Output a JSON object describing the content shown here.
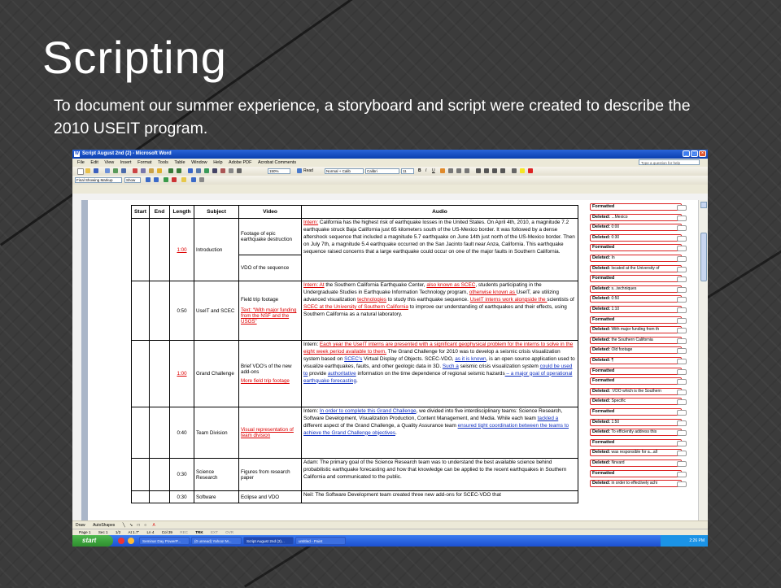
{
  "slide": {
    "title": "Scripting",
    "body": "To document our summer experience, a storyboard and script were created to describe the 2010 USEIT program."
  },
  "window": {
    "title": "Script August 2nd (2) - Microsoft Word",
    "help_box": "Type a question for help",
    "menu": [
      "File",
      "Edit",
      "View",
      "Insert",
      "Format",
      "Tools",
      "Table",
      "Window",
      "Help",
      "Adobe PDF",
      "Acrobat Comments"
    ],
    "zoom": "150%",
    "read_label": "Read",
    "style_value": "Normal + Calib",
    "font_value": "Calibri",
    "size_value": "11",
    "markup_view": "Final Showing Markup",
    "show_label": "Show"
  },
  "table": {
    "headers": [
      "Start",
      "End",
      "Length",
      "Subject",
      "Video",
      "Audio"
    ],
    "rows": [
      {
        "length": "1:00",
        "subject": "Introduction",
        "video_a": "Footage of epic earthquake destruction",
        "video_b": "VDO of the sequence",
        "audio_ins": "Intern:",
        "audio_text": " California has the highest risk of earthquake losses in the United States. On April 4th, 2010, a magnitude 7.2 earthquake struck Baja California just 65 kilometers south of the US-Mexico border. It was followed by a dense aftershock sequence that included a magnitude 5.7 earthquake on June 14th just north of the US-Mexico border. Then on July 7th, a magnitude 5.4 earthquake occurred on the San Jacinto fault near Anza, California. This earthquake sequence raised concerns that a large earthquake could occur on one of the major faults in Southern California."
      },
      {
        "length": "0:50",
        "subject": "UseIT and SCEC",
        "video_a": "Field trip footage",
        "video_ins": "Text: “With major funding from the NSF and the USGS”",
        "audio_a": "Intern: At",
        "audio_b": " the Southern California Earthquake Center, ",
        "audio_c": "also known as SCEC",
        "audio_d": ", students participating in the Undergraduate Studies in Earthquake Information Technology program, ",
        "audio_e": "otherwise known as ",
        "audio_f": "UseIT, are utilizing advanced visualization ",
        "audio_g": "technologies",
        "audio_h": " to study this earthquake sequence. ",
        "audio_i": "UseIT interns work alongside the ",
        "audio_j": "scientists of ",
        "audio_k": "SCEC at the University of Southern California",
        "audio_l": " to improve our understanding of earthquakes and their effects, using Southern California as a natural laboratory."
      },
      {
        "length": "1:00",
        "subject": "Grand Challenge",
        "video_a": "Brief VDO’s of the new add-ons",
        "video_ins": "More field trip footage",
        "audio_a": "Intern: ",
        "audio_b": "Each year the UseIT interns are presented with a significant geophysical problem for the interns to solve in the eight week period available to them.",
        "audio_c": " The Grand Challenge for 2010 was to develop a seismic crisis visualization system based on ",
        "audio_d": "SCEC’s",
        "audio_e": " Virtual Display of Objects. SCEC-VDO, ",
        "audio_f": "as it is known",
        "audio_g": ", is an open source application used to visualize earthquakes, faults, and other geologic data in 3D. ",
        "audio_h": "Such a",
        "audio_i": " seismic crisis visualization system ",
        "audio_j": "could be used to",
        "audio_k": " provide ",
        "audio_l": "authoritative",
        "audio_m": " information on the time dependence of regional seismic hazards",
        "audio_n": " – a major goal of operational earthquake forecasting",
        "audio_o": "."
      },
      {
        "length": "0:40",
        "subject": "Team Division",
        "video_ins": "Visual representation of team division",
        "audio_a": "Intern: ",
        "audio_b": "In order to complete this Grand Challenge",
        "audio_c": ", we divided into five interdisciplinary teams: Science Research, Software Development, Visualization Production, Content Management, and Media. While each team ",
        "audio_d": "tackled a",
        "audio_e": " different aspect of the Grand Challenge, a Quality Assurance team ",
        "audio_f": "ensured tight coordination between the teams to achieve the Grand Challenge objectives",
        "audio_g": "."
      },
      {
        "length": "0:30",
        "subject": "Science Research",
        "video_a": "Figures from research paper",
        "audio": "Adam: The primary goal of the Science Research team was to understand the best available science behind probabilistic earthquake forecasting and how that knowledge can be applied to the recent earthquakes in Southern California and communicated to the public."
      },
      {
        "length": "0:30",
        "subject": "Software",
        "video_a": "Eclipse and VDO",
        "audio": "Neil: The Software Development team created three new add-ons for SCEC-VDO that"
      }
    ]
  },
  "balloons": [
    {
      "label": "Formatted",
      "detail": ""
    },
    {
      "label": "Deleted:",
      "detail": "...Mexico"
    },
    {
      "label": "Deleted:",
      "detail": "0:00"
    },
    {
      "label": "Deleted:",
      "detail": "0:30"
    },
    {
      "label": "Formatted",
      "detail": ""
    },
    {
      "label": "Deleted:",
      "detail": "In"
    },
    {
      "label": "Deleted:",
      "detail": "located at the University of"
    },
    {
      "label": "Formatted",
      "detail": ""
    },
    {
      "label": "Deleted:",
      "detail": "s...techniques"
    },
    {
      "label": "Deleted:",
      "detail": "0:50"
    },
    {
      "label": "Deleted:",
      "detail": "1:10"
    },
    {
      "label": "Formatted",
      "detail": ""
    },
    {
      "label": "Deleted:",
      "detail": "With major funding from th"
    },
    {
      "label": "Deleted:",
      "detail": " the Southern California"
    },
    {
      "label": "Deleted:",
      "detail": "Old footage"
    },
    {
      "label": "Deleted:",
      "detail": "¶"
    },
    {
      "label": "Formatted",
      "detail": ""
    },
    {
      "label": "Formatted",
      "detail": ""
    },
    {
      "label": "Deleted:",
      "detail": ":VDO which is the Southern"
    },
    {
      "label": "Deleted:",
      "detail": "Specific"
    },
    {
      "label": "Formatted",
      "detail": ""
    },
    {
      "label": "Deleted:",
      "detail": "1:50"
    },
    {
      "label": "Deleted:",
      "detail": "To efficiently address this"
    },
    {
      "label": "Formatted",
      "detail": ""
    },
    {
      "label": "Deleted:",
      "detail": "was responsible for a...all"
    },
    {
      "label": "Deleted:",
      "detail": "Nnvard"
    },
    {
      "label": "Formatted",
      "detail": ""
    },
    {
      "label": "Deleted:",
      "detail": "in order to effectively achi"
    }
  ],
  "status": {
    "page": "Page 1",
    "sec": "Sec 1",
    "count": "1/2",
    "at": "At 1.7\"",
    "ln": "Ln 4",
    "col": "Col 39",
    "rec": "REC",
    "trk": "TRK",
    "ext": "EXT",
    "ovr": "OVR"
  },
  "drawbar": {
    "draw": "Draw",
    "autoshapes": "AutoShapes"
  },
  "taskbar": {
    "start": "start",
    "tasks": [
      "Seminar Day PowerP...",
      "(0 unread) Yahoo! M...",
      "Script August 2nd (2)...",
      "untitled - Paint"
    ],
    "clock": "2:26 PM"
  },
  "colors": {
    "insertion": "#1030c0",
    "deletion": "#dd0000",
    "titlebar": "#0b3fb0"
  }
}
